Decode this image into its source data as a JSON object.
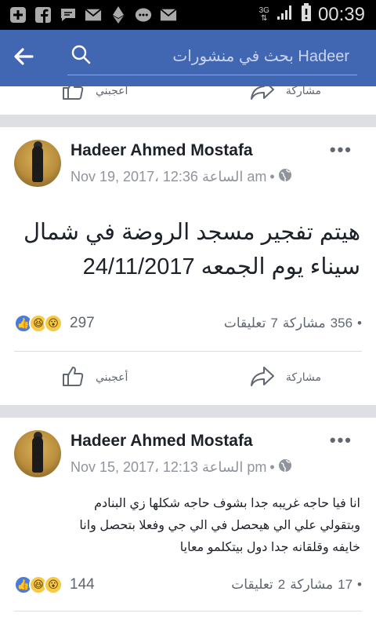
{
  "status_bar": {
    "network": "3G",
    "time": "00:39"
  },
  "app_bar": {
    "search_placeholder": "بحث في منشورات Hadeer"
  },
  "actions": {
    "like_label": "أعجبني",
    "share_label": "مشاركة"
  },
  "posts": [
    {
      "author": "Hadeer Ahmed Mostafa",
      "date": "Nov 19, 2017، 12:36 الساعة am",
      "text_line1": "هيتم تفجير مسجد الروضة في شمال",
      "text_line2": "سيناء يوم الجمعه 24/11/2017",
      "reaction_count": "297",
      "shares_count": "356",
      "shares_label": "مشاركة",
      "comments_count": "7",
      "comments_label": "تعليقات"
    },
    {
      "author": "Hadeer Ahmed Mostafa",
      "date": "Nov 15, 2017، 12:13 الساعة pm",
      "text_line1": "انا فيا حاجه غريبه جدا بشوف حاجه شكلها زي البنادم",
      "text_line2": "وبتقولي علي الي هيحصل في الي جي وفعلا بتحصل وانا",
      "text_line3": "خايفه وقلقانه جدا دول بيتكلمو معايا",
      "reaction_count": "144",
      "shares_count": "17",
      "shares_label": "مشاركة",
      "comments_count": "2",
      "comments_label": "تعليقات"
    }
  ],
  "colors": {
    "brand": "#4267b2",
    "text": "#1d2129",
    "muted": "#90949c"
  }
}
